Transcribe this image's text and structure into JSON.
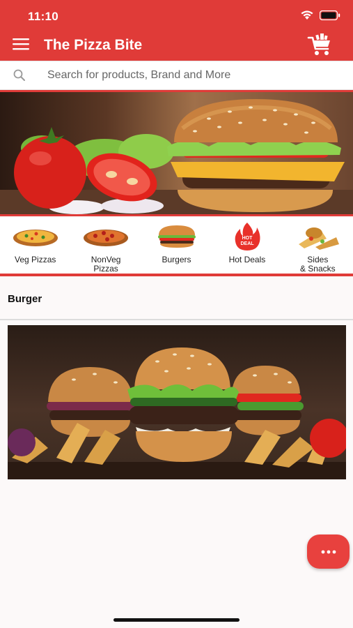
{
  "status_bar": {
    "time": "11:10"
  },
  "header": {
    "title": "The Pizza Bite",
    "icons": {
      "menu": "hamburger-menu-icon",
      "cart": "shopping-cart-icon"
    }
  },
  "search": {
    "placeholder": "Search for products, Brand and More",
    "value": "",
    "icon": "search-icon"
  },
  "categories": [
    {
      "label": "Veg Pizzas",
      "icon": "veg-pizza-icon"
    },
    {
      "label": "NonVeg\nPizzas",
      "icon": "nonveg-pizza-icon"
    },
    {
      "label": "Burgers",
      "icon": "burger-icon"
    },
    {
      "label": "Hot Deals",
      "icon": "hot-deals-icon",
      "badge": "HOT\nDEAL"
    },
    {
      "label": "Sides\n& Snacks",
      "icon": "sides-snacks-icon"
    }
  ],
  "section": {
    "title": "Burger"
  },
  "fab": {
    "icon": "more-dots-icon"
  },
  "colors": {
    "brand_red": "#e03b38",
    "background": "#fcf9f9"
  }
}
